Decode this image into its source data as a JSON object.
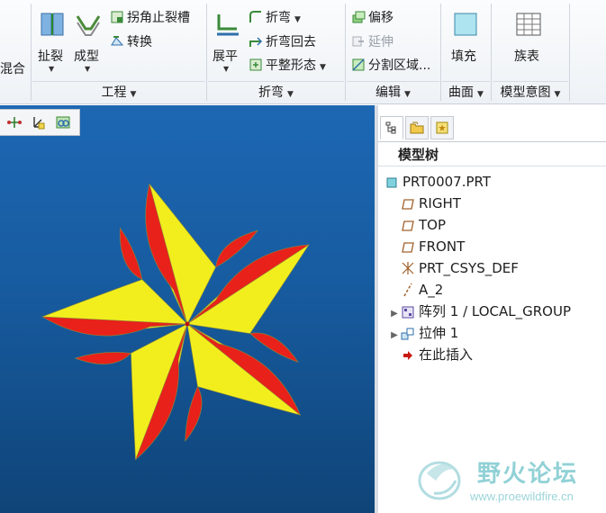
{
  "ribbon": {
    "cut_label": "混合",
    "rip": "扯裂",
    "form": "成型",
    "corner_relief": "拐角止裂槽",
    "convert": "转换",
    "unbend": "展平",
    "bend": "折弯",
    "bend_back": "折弯回去",
    "flatten_form": "平整形态",
    "offset": "偏移",
    "extend": "延伸",
    "split_area": "分割区域...",
    "fill": "填充",
    "family_table": "族表",
    "groups": {
      "engineering": "工程",
      "bends": "折弯",
      "editing": "编辑",
      "surfaces": "曲面",
      "model_intent": "模型意图"
    }
  },
  "model_tree": {
    "heading": "模型树",
    "items": [
      {
        "label": "PRT0007.PRT",
        "icon": "part-icon"
      },
      {
        "label": "RIGHT",
        "icon": "datum-plane-icon"
      },
      {
        "label": "TOP",
        "icon": "datum-plane-icon"
      },
      {
        "label": "FRONT",
        "icon": "datum-plane-icon"
      },
      {
        "label": "PRT_CSYS_DEF",
        "icon": "csys-icon"
      },
      {
        "label": "A_2",
        "icon": "datum-axis-icon"
      },
      {
        "label": "阵列 1 / LOCAL_GROUP",
        "icon": "pattern-icon"
      },
      {
        "label": "拉伸 1",
        "icon": "extrude-icon"
      },
      {
        "label": "在此插入",
        "icon": "insert-here-icon"
      }
    ]
  },
  "watermark": {
    "title": "野火论坛",
    "url": "www.proewildfire.cn"
  },
  "colors": {
    "viewport_top": "#1d67b3",
    "viewport_bottom": "#0f4478",
    "blade_yellow": "#f2ee1e",
    "blade_red": "#e8211a"
  }
}
